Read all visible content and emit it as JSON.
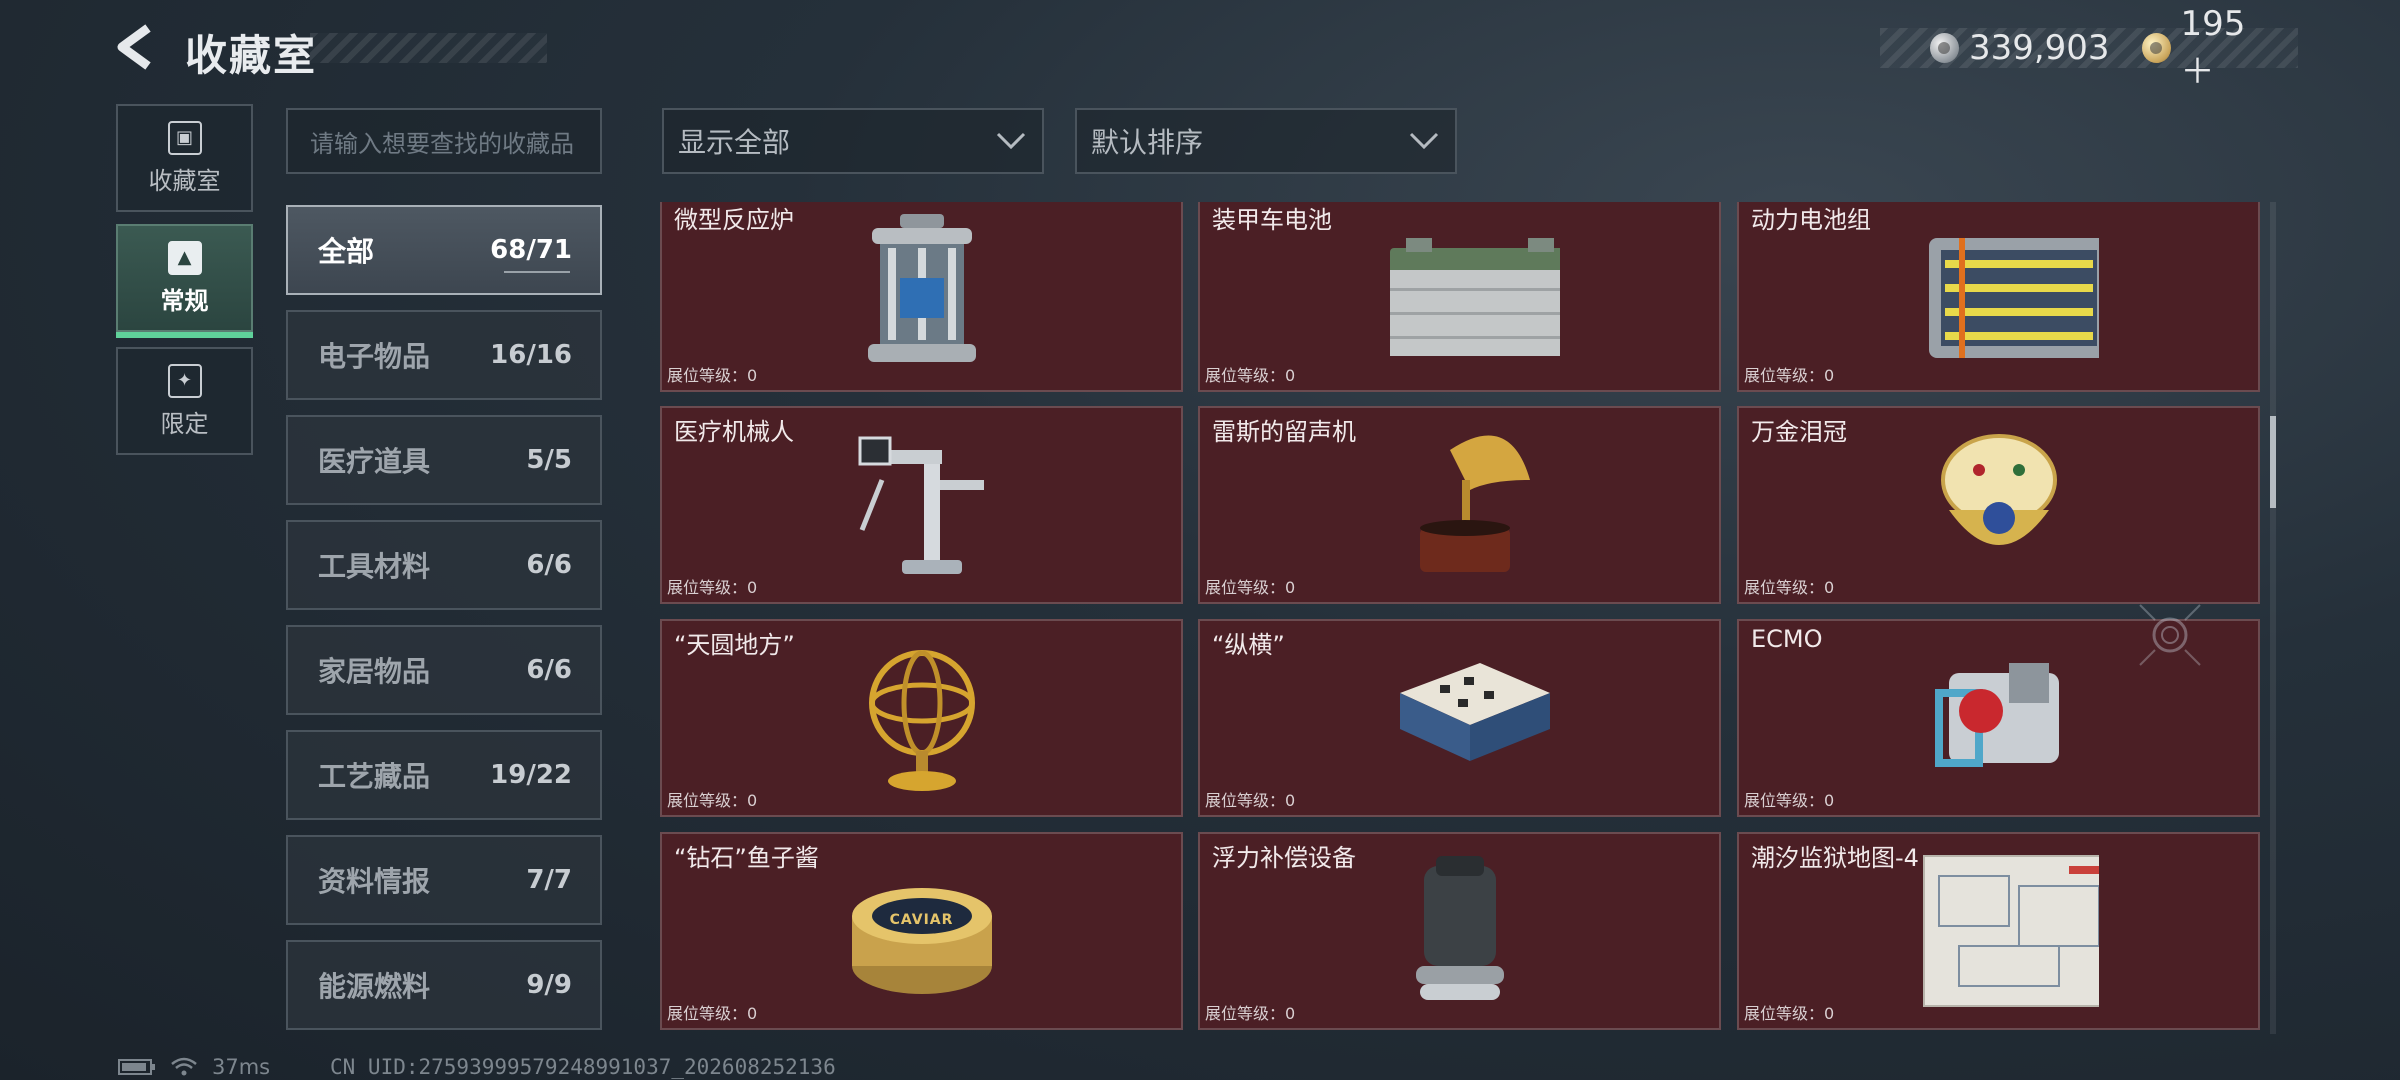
{
  "header": {
    "title": "收藏室",
    "currency": [
      {
        "icon": "silver-coin-icon",
        "value": "339,903"
      },
      {
        "icon": "gold-coin-icon",
        "value": "195＋"
      }
    ]
  },
  "rail": [
    {
      "label": "收藏室",
      "icon": "collection-room-icon",
      "active": false
    },
    {
      "label": "常规",
      "icon": "regular-icon",
      "active": true
    },
    {
      "label": "限定",
      "icon": "limited-icon",
      "active": false
    }
  ],
  "search": {
    "placeholder": "请输入想要查找的收藏品"
  },
  "filters": {
    "display": "显示全部",
    "sort": "默认排序"
  },
  "subcategories": [
    {
      "name": "全部",
      "count": "68/71",
      "active": true
    },
    {
      "name": "电子物品",
      "count": "16/16"
    },
    {
      "name": "医疗道具",
      "count": "5/5"
    },
    {
      "name": "工具材料",
      "count": "6/6"
    },
    {
      "name": "家居物品",
      "count": "6/6"
    },
    {
      "name": "工艺藏品",
      "count": "19/22"
    },
    {
      "name": "资料情报",
      "count": "7/7"
    },
    {
      "name": "能源燃料",
      "count": "9/9"
    }
  ],
  "items": [
    {
      "name": "微型反应炉",
      "level": "展位等级：0",
      "art": "reactor"
    },
    {
      "name": "装甲车电池",
      "level": "展位等级：0",
      "art": "battery"
    },
    {
      "name": "动力电池组",
      "level": "展位等级：0",
      "art": "powerpack"
    },
    {
      "name": "医疗机械人",
      "level": "展位等级：0",
      "art": "medrobot"
    },
    {
      "name": "雷斯的留声机",
      "level": "展位等级：0",
      "art": "gramophone"
    },
    {
      "name": "万金泪冠",
      "level": "展位等级：0",
      "art": "egg"
    },
    {
      "name": "“天圆地方”",
      "level": "展位等级：0",
      "art": "armillary"
    },
    {
      "name": "“纵横”",
      "level": "展位等级：0",
      "art": "chess"
    },
    {
      "name": "ECMO",
      "level": "展位等级：0",
      "art": "ecmo"
    },
    {
      "name": "“钻石”鱼子酱",
      "level": "展位等级：0",
      "art": "caviar"
    },
    {
      "name": "浮力补偿设备",
      "level": "展位等级：0",
      "art": "bcd"
    },
    {
      "name": "潮汐监狱地图-4",
      "level": "展位等级：0",
      "art": "map"
    }
  ],
  "caviar_label": "CAVIAR",
  "footer": {
    "ping": "37ms",
    "uid": "CN UID:27593999579248991037_202608252136"
  }
}
